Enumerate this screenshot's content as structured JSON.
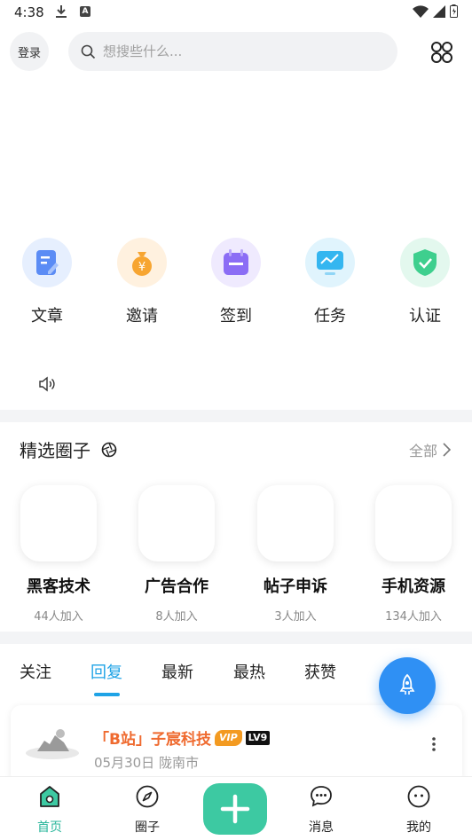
{
  "status_bar": {
    "time": "4:38"
  },
  "header": {
    "login_label": "登录",
    "search_placeholder": "想搜些什么..."
  },
  "quick_actions": [
    {
      "label": "文章",
      "icon": "edit-document-icon",
      "color": "#5b8cf5"
    },
    {
      "label": "邀请",
      "icon": "money-bag-icon",
      "color": "#f7a531"
    },
    {
      "label": "签到",
      "icon": "calendar-icon",
      "color": "#8b6df5"
    },
    {
      "label": "任务",
      "icon": "monitor-chart-icon",
      "color": "#35b6f0"
    },
    {
      "label": "认证",
      "icon": "shield-check-icon",
      "color": "#3ecf8e"
    }
  ],
  "circles_section": {
    "title": "精选圈子",
    "all_label": "全部",
    "items": [
      {
        "name": "黑客技术",
        "count": "44人加入"
      },
      {
        "name": "广告合作",
        "count": "8人加入"
      },
      {
        "name": "帖子申诉",
        "count": "3人加入"
      },
      {
        "name": "手机资源",
        "count": "134人加入"
      }
    ]
  },
  "tabs": [
    {
      "label": "关注"
    },
    {
      "label": "回复",
      "active": true
    },
    {
      "label": "最新"
    },
    {
      "label": "最热"
    },
    {
      "label": "获赞"
    }
  ],
  "post": {
    "author": "「B站」子宸科技",
    "vip_label": "VIP",
    "level_label": "LV9",
    "meta": "05月30日 陇南市"
  },
  "bottom_nav": [
    {
      "label": "首页",
      "icon": "home-icon",
      "active": true
    },
    {
      "label": "圈子",
      "icon": "compass-icon"
    },
    {
      "label": "消息",
      "icon": "chat-icon"
    },
    {
      "label": "我的",
      "icon": "profile-face-icon"
    }
  ],
  "colors": {
    "accent_blue": "#1fa3e6",
    "accent_green": "#3dc9a2",
    "author_orange": "#ef6a2f"
  }
}
